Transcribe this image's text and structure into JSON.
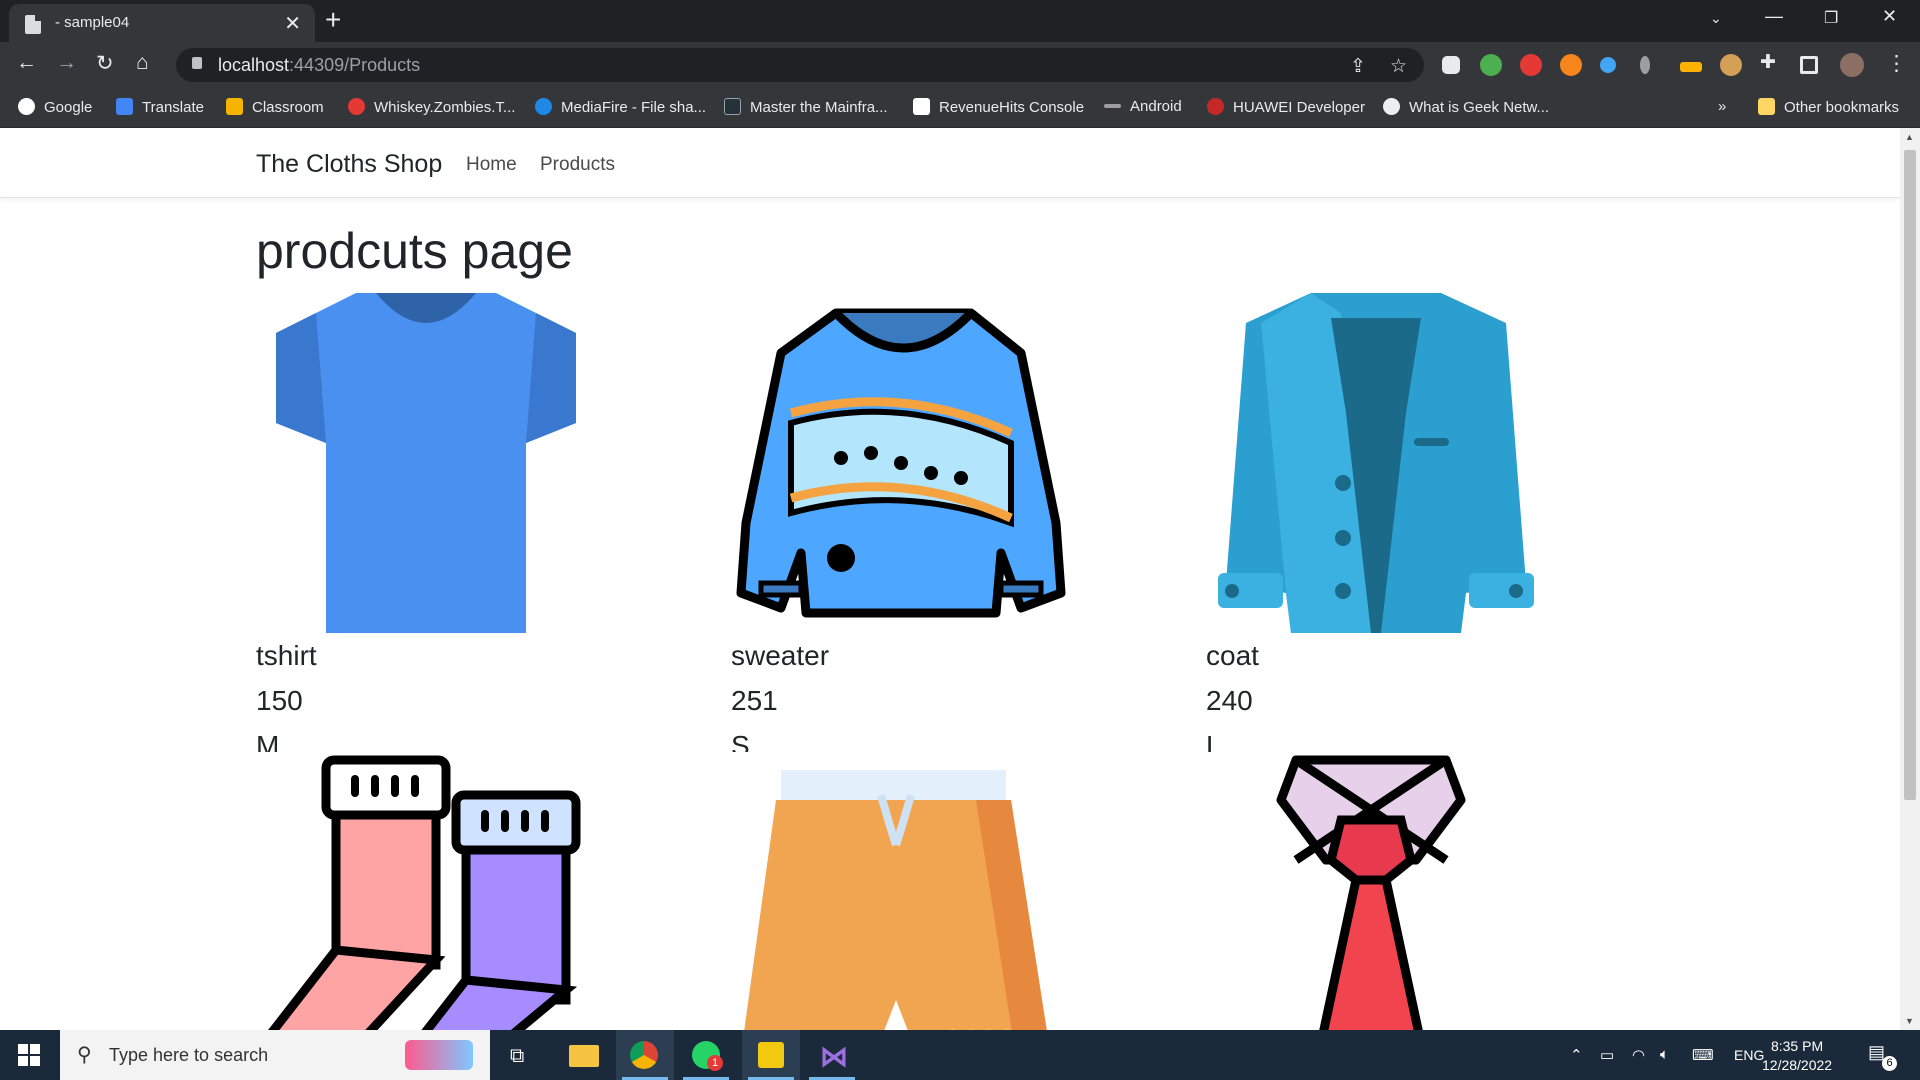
{
  "browser": {
    "tab_title": "- sample04",
    "url_host": "localhost",
    "url_path": ":44309/Products",
    "bookmarks": [
      {
        "label": "Google",
        "color": "#ffffff"
      },
      {
        "label": "Translate",
        "color": "#4285f4"
      },
      {
        "label": "Classroom",
        "color": "#f4b400"
      },
      {
        "label": "Whiskey.Zombies.T...",
        "color": "#e53935"
      },
      {
        "label": "MediaFire - File sha...",
        "color": "#1e88e5"
      },
      {
        "label": "Master the Mainfra...",
        "color": "#263238"
      },
      {
        "label": "RevenueHits Console",
        "color": "#ffffff"
      },
      {
        "label": "Android",
        "color": "#9e9e9e"
      },
      {
        "label": "HUAWEI Developer",
        "color": "#c62828"
      },
      {
        "label": "What is Geek Netw...",
        "color": "#eeeeee"
      }
    ],
    "overflow": "»",
    "other_bookmarks": "Other bookmarks"
  },
  "site": {
    "brand": "The Cloths Shop",
    "nav": [
      "Home",
      "Products"
    ],
    "heading": "prodcuts page"
  },
  "products": [
    {
      "name": "tshirt",
      "price": "150",
      "size": "M",
      "icon": "tshirt-icon"
    },
    {
      "name": "sweater",
      "price": "251",
      "size": "S",
      "icon": "sweater-icon"
    },
    {
      "name": "coat",
      "price": "240",
      "size": "L",
      "icon": "coat-icon"
    },
    {
      "name": "",
      "price": "",
      "size": "",
      "icon": "socks-icon"
    },
    {
      "name": "",
      "price": "",
      "size": "",
      "icon": "shorts-icon"
    },
    {
      "name": "",
      "price": "",
      "size": "",
      "icon": "tie-icon"
    }
  ],
  "taskbar": {
    "search_placeholder": "Type here to search",
    "language": "ENG",
    "time": "8:35 PM",
    "date": "12/28/2022",
    "notifications": "6",
    "whatsapp_badge": "1"
  }
}
